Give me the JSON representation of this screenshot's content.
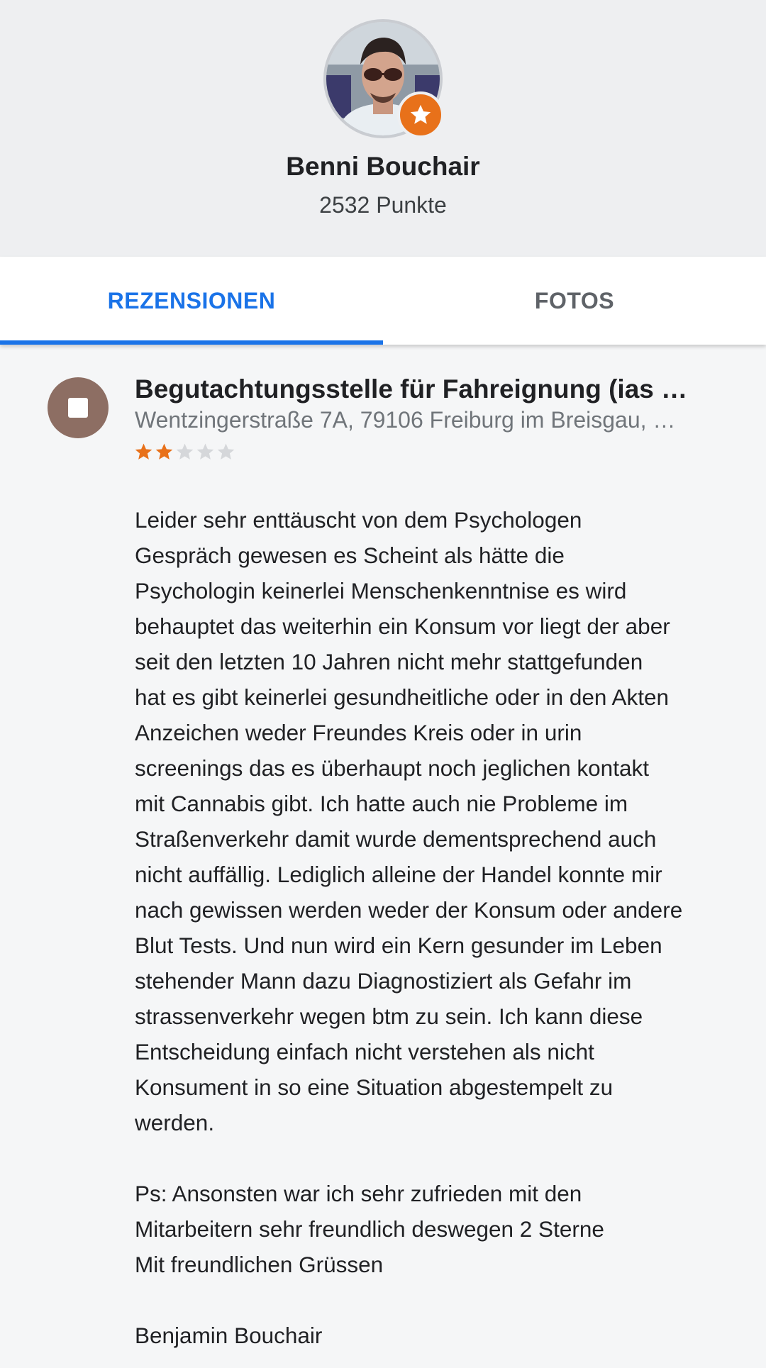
{
  "profile": {
    "name": "Benni Bouchair",
    "points": "2532 Punkte",
    "badge_icon": "local-guide-star-icon",
    "badge_color": "#e8711a"
  },
  "tabs": [
    {
      "label": "REZENSIONEN",
      "active": true
    },
    {
      "label": "FOTOS",
      "active": false
    }
  ],
  "accent_color": "#1a73e8",
  "review": {
    "place_name": "Begutachtungsstelle für Fahreignung (ias …",
    "place_address": "Wentzingerstraße 7A, 79106 Freiburg im Breisgau, …",
    "place_icon": "stop-square-icon",
    "rating": 2,
    "max_rating": 5,
    "star_color": "#e8711a",
    "lines": [
      "Leider sehr enttäuscht von dem Psychologen",
      "Gespräch gewesen es Scheint als hätte die",
      "Psychologin keinerlei Menschenkenntnise es wird",
      "behauptet das weiterhin ein Konsum vor liegt der aber",
      "seit den letzten 10 Jahren nicht mehr stattgefunden",
      "hat es gibt keinerlei gesundheitliche oder in den Akten",
      "Anzeichen weder Freundes Kreis oder in urin",
      "screenings das es überhaupt noch jeglichen kontakt",
      "mit Cannabis gibt. Ich hatte auch nie Probleme im",
      "Straßenverkehr damit wurde dementsprechend auch",
      "nicht auffällig. Lediglich alleine der Handel konnte mir",
      "nach gewissen werden weder der Konsum oder andere",
      "Blut Tests. Und nun wird ein Kern gesunder im Leben",
      "stehender Mann dazu Diagnostiziert als Gefahr im",
      "strassenverkehr wegen btm zu sein. Ich kann diese",
      "Entscheidung einfach nicht verstehen als nicht",
      "Konsument in so eine Situation abgestempelt zu",
      "werden.",
      "",
      "Ps: Ansonsten war ich sehr zufrieden mit den",
      "Mitarbeitern sehr freundlich deswegen 2 Sterne",
      "Mit freundlichen Grüssen",
      "",
      "Benjamin Bouchair"
    ]
  }
}
